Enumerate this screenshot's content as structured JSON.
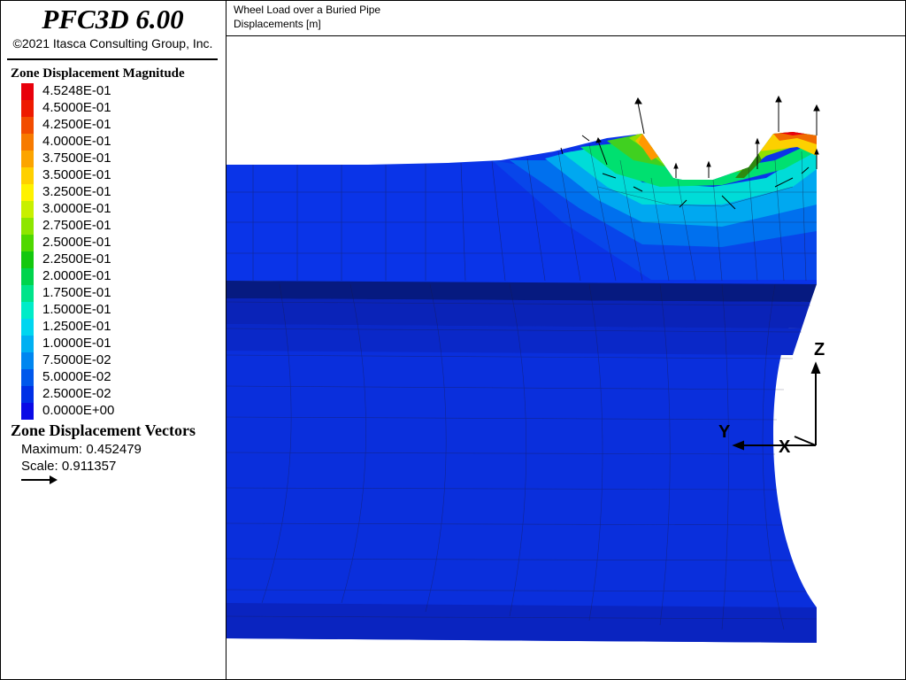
{
  "app": {
    "title": "PFC3D 6.00",
    "copyright": "©2021 Itasca Consulting Group, Inc."
  },
  "legend": {
    "title": "Zone Displacement Magnitude",
    "entries": [
      {
        "label": "4.5248E-01",
        "color": "#e8000c"
      },
      {
        "label": "4.5000E-01",
        "color": "#ee1a00"
      },
      {
        "label": "4.2500E-01",
        "color": "#f24c00"
      },
      {
        "label": "4.0000E-01",
        "color": "#f77a00"
      },
      {
        "label": "3.7500E-01",
        "color": "#fca400"
      },
      {
        "label": "3.5000E-01",
        "color": "#ffd000"
      },
      {
        "label": "3.2500E-01",
        "color": "#fff200"
      },
      {
        "label": "3.0000E-01",
        "color": "#c8f000"
      },
      {
        "label": "2.7500E-01",
        "color": "#8ee600"
      },
      {
        "label": "2.5000E-01",
        "color": "#4fd800"
      },
      {
        "label": "2.2500E-01",
        "color": "#14c80e"
      },
      {
        "label": "2.0000E-01",
        "color": "#00d44c"
      },
      {
        "label": "1.7500E-01",
        "color": "#00e48a"
      },
      {
        "label": "1.5000E-01",
        "color": "#00ecc8"
      },
      {
        "label": "1.2500E-01",
        "color": "#00d6f0"
      },
      {
        "label": "1.0000E-01",
        "color": "#00b0f2"
      },
      {
        "label": "7.5000E-02",
        "color": "#0086f0"
      },
      {
        "label": "5.0000E-02",
        "color": "#0058ec"
      },
      {
        "label": "2.5000E-02",
        "color": "#0030e6"
      },
      {
        "label": "0.0000E+00",
        "color": "#0a0ae6"
      }
    ]
  },
  "vectors": {
    "title": "Zone Displacement Vectors",
    "maximum_label": "Maximum: 0.452479",
    "scale_label": "Scale: 0.911357"
  },
  "plot": {
    "title": "Wheel Load over a Buried Pipe",
    "subtitle": "Displacements [m]"
  },
  "axes": {
    "z_label": "Z",
    "y_label": "Y",
    "x_label": "X"
  },
  "colors": {
    "soil_base": "#0a32e8",
    "pipe_wall": "#0a2ad8",
    "pipe_dark": "#061a9a",
    "mesh_line": "#1a1a40"
  }
}
